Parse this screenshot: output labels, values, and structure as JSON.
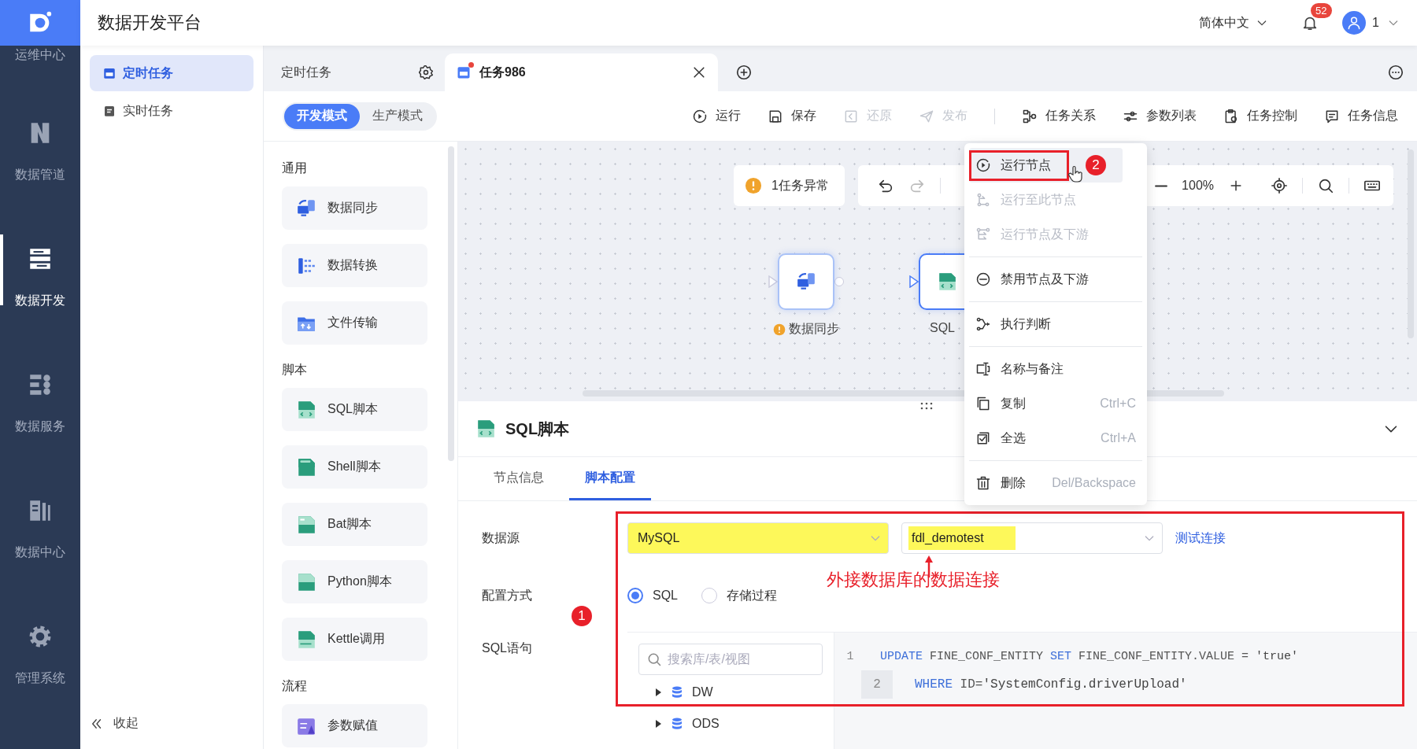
{
  "app": {
    "title": "数据开发平台",
    "language": "简体中文",
    "notification_count": "52",
    "user": "1"
  },
  "nav": [
    {
      "label": "运维中心",
      "selected": false
    },
    {
      "label": "数据管道",
      "selected": false
    },
    {
      "label": "数据开发",
      "selected": true
    },
    {
      "label": "数据服务",
      "selected": false
    },
    {
      "label": "数据中心",
      "selected": false
    },
    {
      "label": "管理系统",
      "selected": false
    }
  ],
  "sidebar": {
    "items": [
      {
        "label": "定时任务",
        "selected": true
      },
      {
        "label": "实时任务",
        "selected": false
      }
    ],
    "collapse": "收起"
  },
  "tabs": [
    {
      "label": "定时任务",
      "kind": "home",
      "selected": false,
      "modified": false
    },
    {
      "label": "任务986",
      "kind": "task",
      "selected": true,
      "modified": true
    }
  ],
  "modes": [
    {
      "label": "开发模式",
      "selected": true
    },
    {
      "label": "生产模式",
      "selected": false
    }
  ],
  "edit_actions": [
    {
      "label": "运行",
      "disabled": false
    },
    {
      "label": "保存",
      "disabled": false
    },
    {
      "label": "还原",
      "disabled": true
    },
    {
      "label": "发布",
      "disabled": true
    }
  ],
  "view_actions": [
    {
      "label": "任务关系"
    },
    {
      "label": "参数列表"
    },
    {
      "label": "任务控制"
    },
    {
      "label": "任务信息"
    }
  ],
  "palette": [
    {
      "title": "通用",
      "items": [
        {
          "label": "数据同步",
          "kind": "sync"
        },
        {
          "label": "数据转换",
          "kind": "transform"
        },
        {
          "label": "文件传输",
          "kind": "file"
        }
      ]
    },
    {
      "title": "脚本",
      "items": [
        {
          "label": "SQL脚本",
          "kind": "sql"
        },
        {
          "label": "Shell脚本",
          "kind": "shell"
        },
        {
          "label": "Bat脚本",
          "kind": "bat"
        },
        {
          "label": "Python脚本",
          "kind": "python"
        },
        {
          "label": "Kettle调用",
          "kind": "kettle"
        }
      ]
    },
    {
      "title": "流程",
      "items": [
        {
          "label": "参数赋值",
          "kind": "param"
        }
      ]
    }
  ],
  "canvas": {
    "alert": "1任务异常",
    "zoom": "100%",
    "nodes": [
      {
        "label": "数据同步",
        "kind": "sync",
        "warning": true,
        "selected": false
      },
      {
        "label": "SQL",
        "kind": "sql",
        "warning": false,
        "selected": true
      }
    ]
  },
  "context_menu": [
    {
      "kind": "item",
      "label": "运行节点",
      "disabled": false,
      "highlighted": true,
      "badge": "2"
    },
    {
      "kind": "item",
      "label": "运行至此节点",
      "disabled": true,
      "highlighted": false
    },
    {
      "kind": "item",
      "label": "运行节点及下游",
      "disabled": true,
      "highlighted": false
    },
    {
      "kind": "divider"
    },
    {
      "kind": "item",
      "label": "禁用节点及下游",
      "disabled": false,
      "highlighted": false
    },
    {
      "kind": "divider"
    },
    {
      "kind": "item",
      "label": "执行判断",
      "disabled": false,
      "highlighted": false
    },
    {
      "kind": "divider"
    },
    {
      "kind": "item",
      "label": "名称与备注",
      "disabled": false,
      "highlighted": false
    },
    {
      "kind": "item",
      "label": "复制",
      "shortcut": "Ctrl+C",
      "disabled": false,
      "highlighted": false
    },
    {
      "kind": "item",
      "label": "全选",
      "shortcut": "Ctrl+A",
      "disabled": false,
      "highlighted": false
    },
    {
      "kind": "divider"
    },
    {
      "kind": "item",
      "label": "删除",
      "shortcut": "Del/Backspace",
      "disabled": false,
      "highlighted": false
    }
  ],
  "panel": {
    "title": "SQL脚本",
    "tabs": [
      {
        "label": "节点信息",
        "selected": false
      },
      {
        "label": "脚本配置",
        "selected": true
      }
    ],
    "datasource": {
      "label": "数据源",
      "selects": [
        {
          "value": "MySQL",
          "highlighted": true
        },
        {
          "value": "fdl_demotest",
          "highlighted": true
        }
      ],
      "link": "测试连接"
    },
    "config": {
      "label": "配置方式",
      "options": [
        {
          "label": "SQL",
          "selected": true
        },
        {
          "label": "存储过程",
          "selected": false
        }
      ]
    },
    "sql": {
      "label": "SQL语句",
      "search_placeholder": "搜索库/表/视图",
      "tree": [
        {
          "label": "DW",
          "expanded": false
        },
        {
          "label": "ODS",
          "expanded": false
        }
      ],
      "lines": [
        {
          "number": "1",
          "active": false,
          "tokens": [
            {
              "text": "UPDATE",
              "kind": "keyword"
            },
            {
              "text": " FINE_CONF_ENTITY ",
              "kind": "plain"
            },
            {
              "text": "SET",
              "kind": "keyword"
            },
            {
              "text": " FINE_CONF_ENTITY.VALUE = ",
              "kind": "plain"
            },
            {
              "text": "'true'",
              "kind": "string"
            }
          ]
        },
        {
          "number": "2",
          "active": true,
          "tokens": [
            {
              "text": "WHERE",
              "kind": "keyword"
            },
            {
              "text": " ID=",
              "kind": "plain"
            },
            {
              "text": "'SystemConfig.driverUpload'",
              "kind": "string"
            }
          ]
        }
      ]
    },
    "annotation": {
      "note": "外接数据库的数据连接",
      "badge": "1"
    }
  }
}
